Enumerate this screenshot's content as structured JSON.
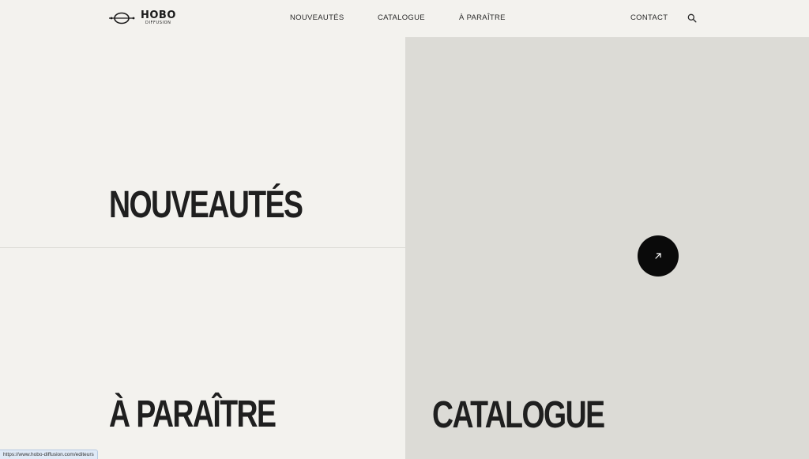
{
  "header": {
    "logo": {
      "word": "HOBO",
      "sub": "DIFFUSION",
      "icon": "orbit-logo-icon"
    },
    "nav": [
      {
        "label": "NOUVEAUTÉS"
      },
      {
        "label": "CATALOGUE"
      },
      {
        "label": "À PARAÎTRE"
      }
    ],
    "contact_label": "CONTACT",
    "search_icon": "search-icon"
  },
  "panels": {
    "nouveautes_title": "NOUVEAUTÉS",
    "aparaitre_title": "À PARAÎTRE",
    "catalogue_title": "CATALOGUE",
    "arrow_icon": "arrow-up-right-icon"
  },
  "status_bar": {
    "url": "https://www.hobo-diffusion.com/editeurs"
  },
  "colors": {
    "background": "#f3f2ee",
    "panel_grey": "#dcdbd6",
    "text": "#1f1f1f",
    "button": "#0a0a0a"
  }
}
